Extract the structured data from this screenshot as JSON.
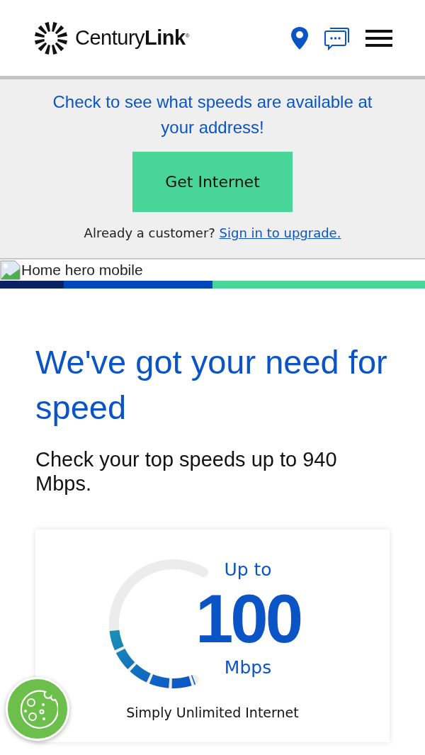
{
  "header": {
    "logo_text": "Century",
    "logo_bold": "Link",
    "logo_mark": "®"
  },
  "promo": {
    "text": "Check to see what speeds are available at your address!",
    "button": "Get Internet",
    "customer_prompt": "Already a customer?",
    "sign_in_link": "Sign in to upgrade."
  },
  "hero_image": {
    "alt": "Home hero mobile"
  },
  "headline": "We've got your need for speed",
  "subheading": "Check your top speeds up to 940 Mbps.",
  "speed_card": {
    "prefix": "Up to",
    "speed": "100",
    "unit": "Mbps",
    "plan": "Simply Unlimited Internet"
  }
}
